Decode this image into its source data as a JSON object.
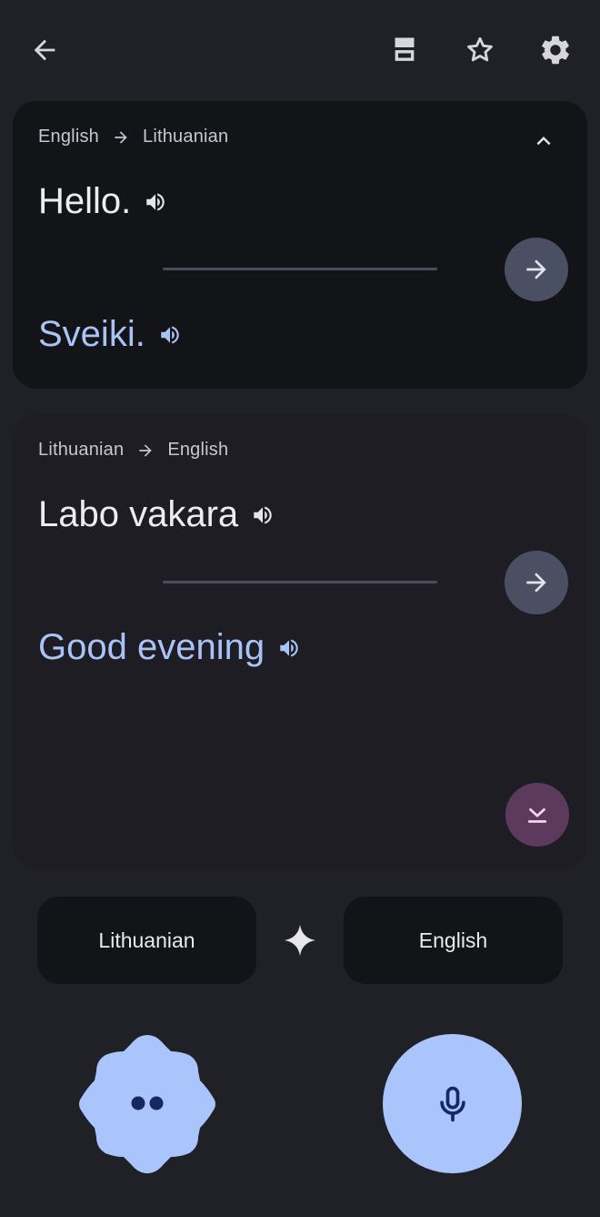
{
  "toolbar": {
    "back_icon": "arrow-left-icon",
    "layout_icon": "split-view-icon",
    "star_icon": "star-outline-icon",
    "settings_icon": "gear-icon"
  },
  "cards": [
    {
      "source_lang": "English",
      "target_lang": "Lithuanian",
      "source_text": "Hello.",
      "target_text": "Sveiki.",
      "expanded": true
    },
    {
      "source_lang": "Lithuanian",
      "target_lang": "English",
      "source_text": "Labo vakara",
      "target_text": "Good evening"
    }
  ],
  "language_selector": {
    "left": "Lithuanian",
    "right": "English"
  },
  "colors": {
    "background": "#202027",
    "card_active": "#131418",
    "card_inactive": "#1d1d23",
    "translation_text": "#a9c3f7",
    "primary_button": "#a9c5fb",
    "scroll_down_button": "#5b3a5e"
  }
}
